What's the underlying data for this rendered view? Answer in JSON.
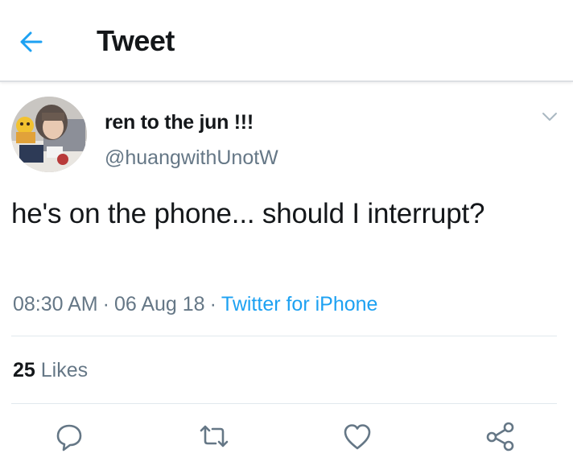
{
  "header": {
    "title": "Tweet"
  },
  "tweet": {
    "display_name": "ren to the jun !!!",
    "handle": "@huangwithUnotW",
    "text": "he's on the phone... should I interrupt?",
    "time": "08:30 AM",
    "date": "06 Aug 18",
    "source": "Twitter for iPhone",
    "likes_count": "25",
    "likes_label": "Likes"
  },
  "actions": {
    "icons": [
      "reply-icon",
      "retweet-icon",
      "like-icon",
      "share-icon"
    ]
  },
  "colors": {
    "accent": "#1da1f2",
    "secondary_text": "#657786",
    "primary_text": "#14171a",
    "divider": "#e1e8ed",
    "icon": "#657786"
  }
}
